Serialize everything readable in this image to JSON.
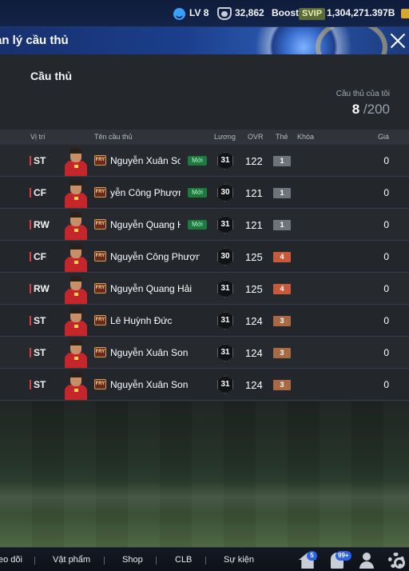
{
  "topbar": {
    "level": "LV 8",
    "coins": "32,862",
    "boost_label": "Boost",
    "svip_label": "SVIP",
    "bp": "1,304,271.397B"
  },
  "header": {
    "title": "ản lý cầu thủ"
  },
  "section": {
    "title": "Cầu thủ",
    "own_label": "Cầu thủ của tôi",
    "own_count": "8",
    "own_max": "/200"
  },
  "table": {
    "columns": {
      "position": "Vị trí",
      "name": "Tên cầu thủ",
      "salary": "Lương",
      "ovr": "OVR",
      "grade": "Thẻ",
      "lock": "Khóa",
      "price": "Giá"
    },
    "rows": [
      {
        "pos": "ST",
        "season": "FRY",
        "name": "Nguyễn Xuân Son",
        "new": "Mới",
        "salary": "31",
        "ovr": "122",
        "grade": "1",
        "price": "0"
      },
      {
        "pos": "CF",
        "season": "FRY",
        "name": "yễn Công Phượng",
        "new": "Mới",
        "salary": "30",
        "ovr": "121",
        "grade": "1",
        "price": "0"
      },
      {
        "pos": "RW",
        "season": "FRY",
        "name": "Nguyễn Quang Hả",
        "new": "Mới",
        "salary": "31",
        "ovr": "121",
        "grade": "1",
        "price": "0"
      },
      {
        "pos": "CF",
        "season": "FRY",
        "name": "Nguyễn Công Phượng",
        "new": "",
        "salary": "30",
        "ovr": "125",
        "grade": "4",
        "price": "0"
      },
      {
        "pos": "RW",
        "season": "FRY",
        "name": "Nguyễn Quang Hải",
        "new": "",
        "salary": "31",
        "ovr": "125",
        "grade": "4",
        "price": "0"
      },
      {
        "pos": "ST",
        "season": "FRY",
        "name": "Lê Huỳnh Đức",
        "new": "",
        "salary": "31",
        "ovr": "124",
        "grade": "3",
        "price": "0"
      },
      {
        "pos": "ST",
        "season": "FRY",
        "name": "Nguyễn Xuân Son",
        "new": "",
        "salary": "31",
        "ovr": "124",
        "grade": "3",
        "price": "0"
      },
      {
        "pos": "ST",
        "season": "FRY",
        "name": "Nguyễn Xuân Son",
        "new": "",
        "salary": "31",
        "ovr": "124",
        "grade": "3",
        "price": "0"
      }
    ]
  },
  "bottom_nav": {
    "items": [
      "eo dõi",
      "Vật phẩm",
      "Shop",
      "CLB",
      "Sự kiện"
    ],
    "home_badge": "5",
    "bell_badge": "99+"
  },
  "colors": {
    "accent_red": "#e2393c",
    "new_green": "#1d7a3e",
    "grade_gray": "#6f747b",
    "grade_bronze": "#a86a45",
    "grade_orange": "#c75a3a"
  }
}
